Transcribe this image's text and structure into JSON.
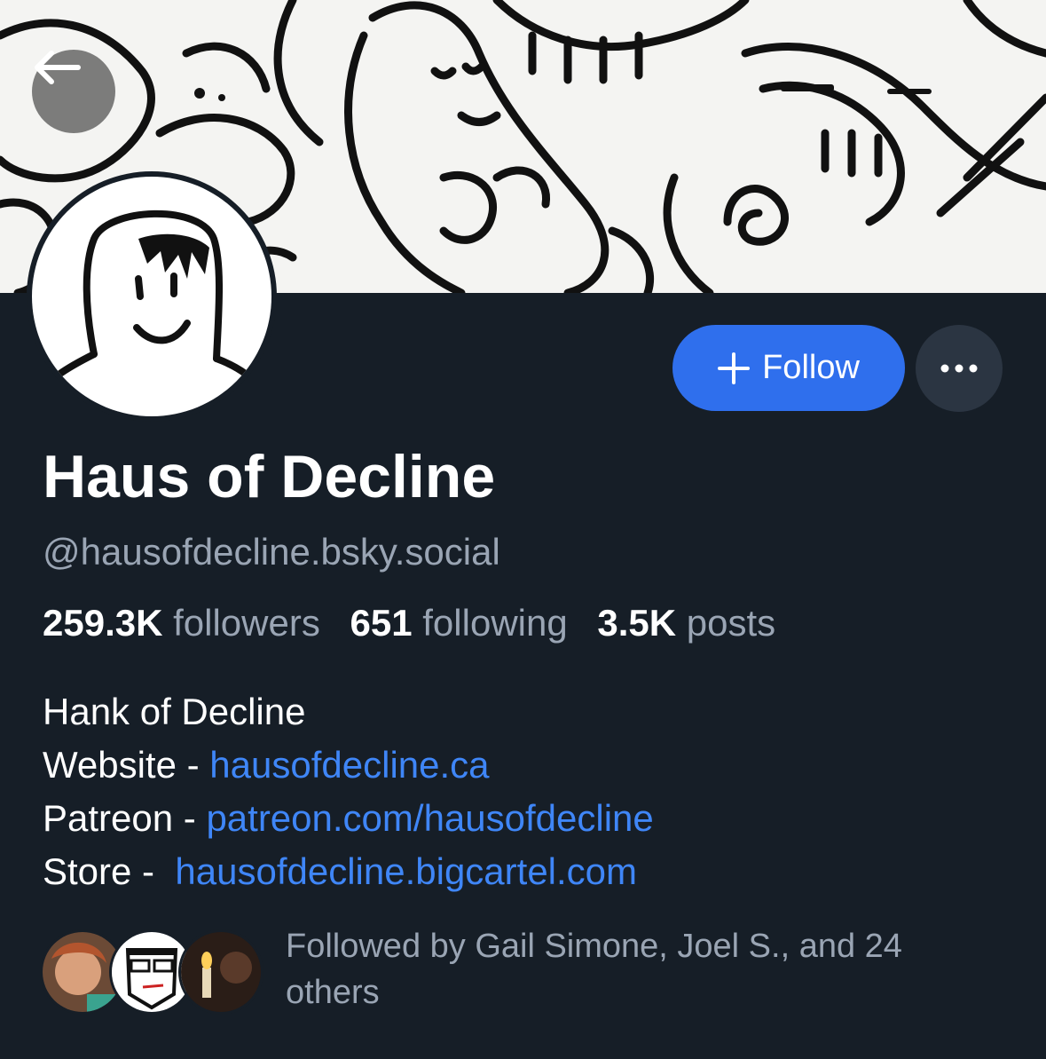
{
  "profile": {
    "display_name": "Haus of Decline",
    "handle": "@hausofdecline.bsky.social"
  },
  "actions": {
    "follow_label": "Follow",
    "follow_icon": "plus-icon",
    "more_icon": "ellipsis-icon",
    "back_icon": "arrow-left-icon"
  },
  "stats": {
    "followers_count": "259.3K",
    "followers_label": "followers",
    "following_count": "651",
    "following_label": "following",
    "posts_count": "3.5K",
    "posts_label": "posts"
  },
  "bio": {
    "line1": "Hank of Decline",
    "website_prefix": "Website - ",
    "website_link": "hausofdecline.ca",
    "patreon_prefix": "Patreon - ",
    "patreon_link": "patreon.com/hausofdecline",
    "store_prefix": "Store - ",
    "store_link": "hausofdecline.bigcartel.com"
  },
  "followed_by": {
    "text": "Followed by Gail Simone, Joel S., and 24 others"
  },
  "colors": {
    "background": "#161e27",
    "accent": "#2f6fed",
    "link": "#3f86f7",
    "muted_text": "#9aa5b4"
  }
}
